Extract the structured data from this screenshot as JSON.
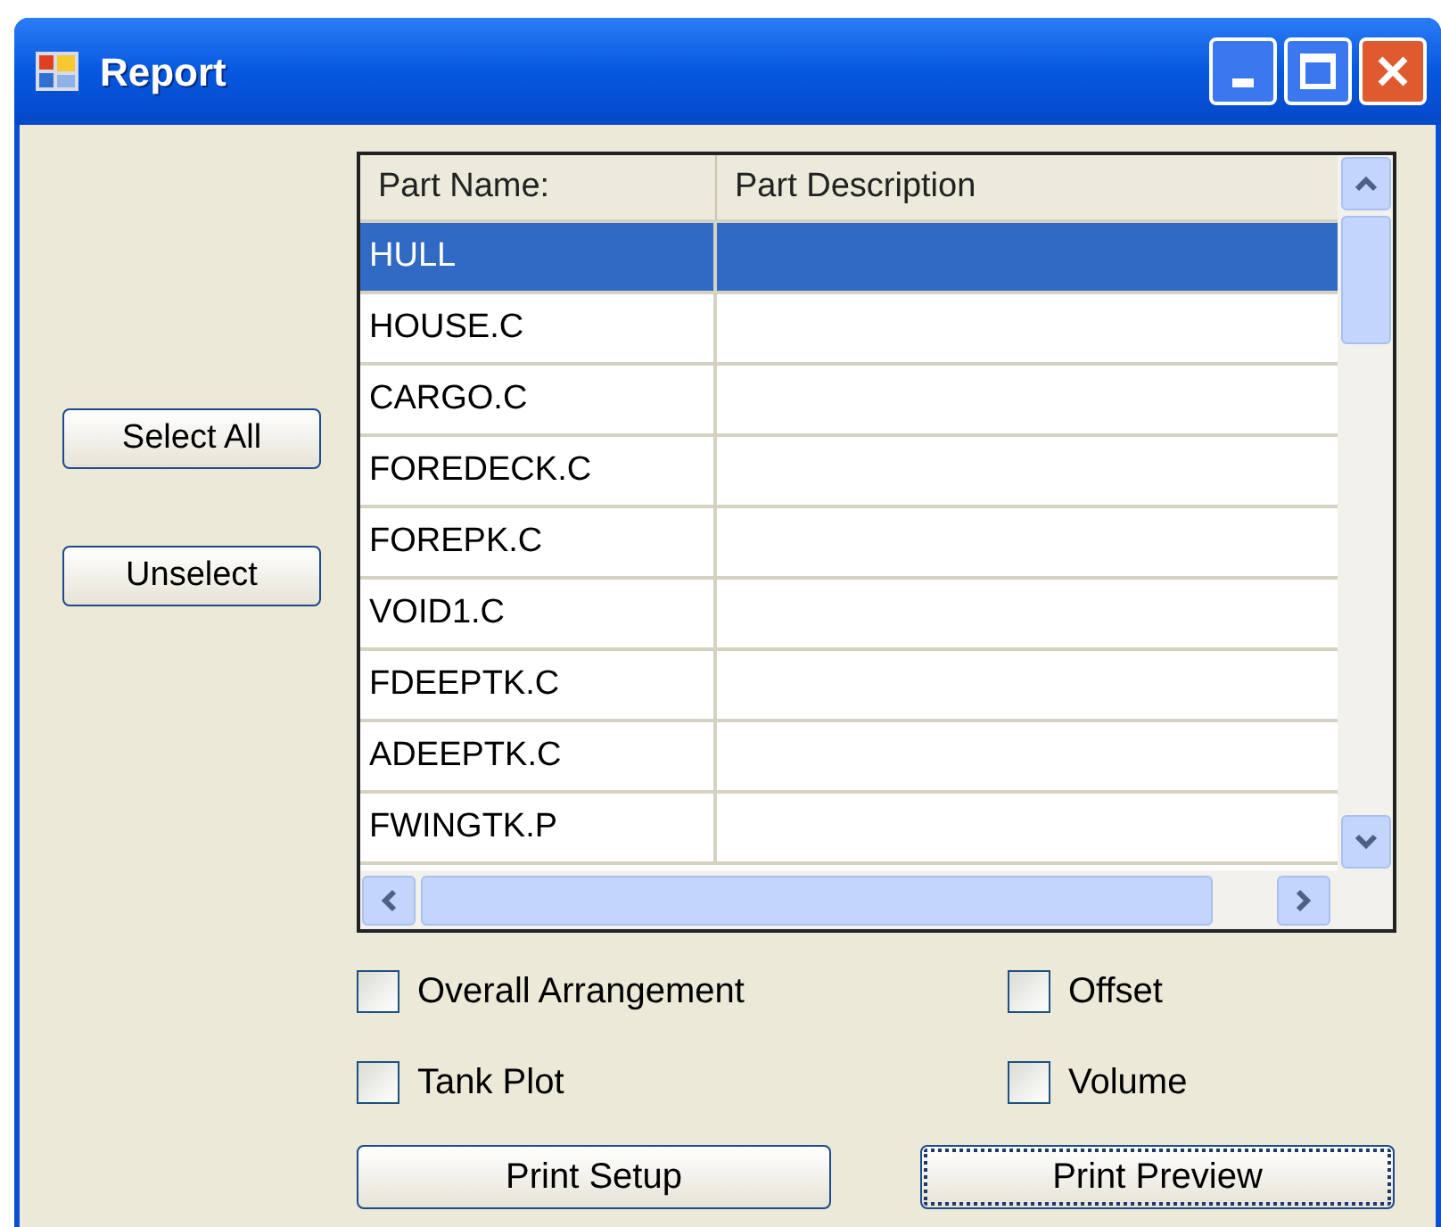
{
  "window": {
    "title": "Report"
  },
  "side_buttons": [
    {
      "label": "Select All"
    },
    {
      "label": "Unselect"
    }
  ],
  "table": {
    "columns": [
      "Part Name:",
      "Part Description"
    ],
    "rows": [
      {
        "part_name": "HULL",
        "selected": true
      },
      {
        "part_name": "HOUSE.C",
        "selected": false
      },
      {
        "part_name": "CARGO.C",
        "selected": false
      },
      {
        "part_name": "FOREDECK.C",
        "selected": false
      },
      {
        "part_name": "FOREPK.C",
        "selected": false
      },
      {
        "part_name": "VOID1.C",
        "selected": false
      },
      {
        "part_name": "FDEEPTK.C",
        "selected": false
      },
      {
        "part_name": "ADEEPTK.C",
        "selected": false
      },
      {
        "part_name": "FWINGTK.P",
        "selected": false
      }
    ]
  },
  "options": [
    {
      "label": "Overall Arrangement",
      "checked": false
    },
    {
      "label": "Offset",
      "checked": false
    },
    {
      "label": "Tank Plot",
      "checked": false
    },
    {
      "label": "Volume",
      "checked": false
    }
  ],
  "buttons": [
    {
      "label": "Print Setup",
      "focused": false
    },
    {
      "label": "Print Preview",
      "focused": true
    }
  ]
}
